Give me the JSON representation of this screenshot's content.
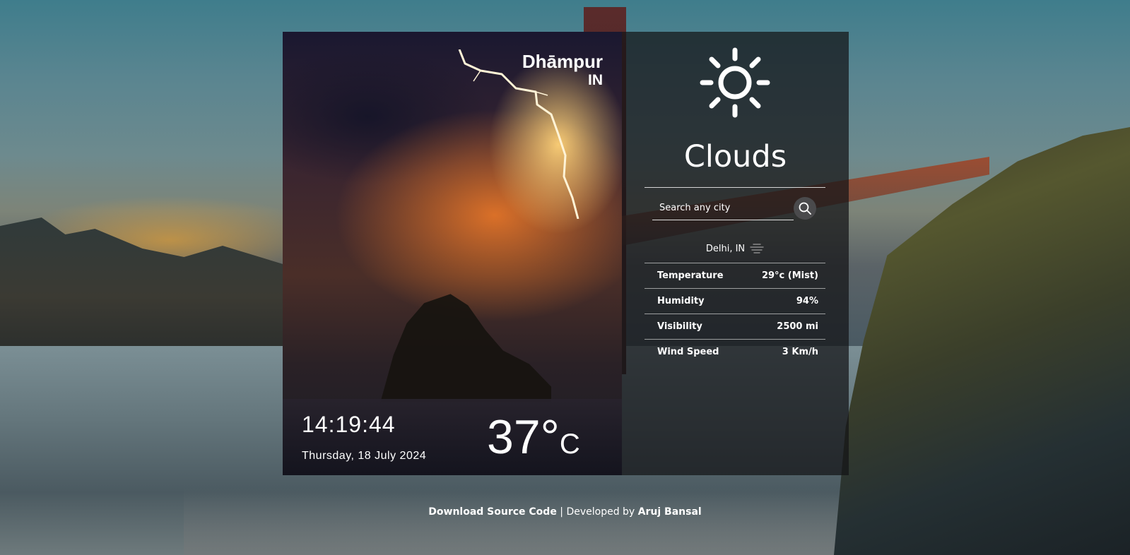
{
  "location": {
    "city": "Dhāmpur",
    "country": "IN"
  },
  "clock": {
    "time": "14:19:44",
    "date": "Thursday, 18 July 2024"
  },
  "current_temp": {
    "value": "37",
    "degree": "°",
    "unit": "C"
  },
  "weather": {
    "icon": "sun-icon",
    "condition": "Clouds"
  },
  "search": {
    "placeholder": "Search any city",
    "button_icon": "search-icon"
  },
  "result": {
    "place": "Delhi, IN",
    "icon": "mist-icon",
    "rows": [
      {
        "label": "Temperature",
        "value": "29°c (Mist)"
      },
      {
        "label": "Humidity",
        "value": "94%"
      },
      {
        "label": "Visibility",
        "value": "2500 mi"
      },
      {
        "label": "Wind Speed",
        "value": "3 Km/h"
      }
    ]
  },
  "footer": {
    "source_link": "Download Source Code",
    "separator": "|",
    "developed_by": "Developed by",
    "developer": "Aruj Bansal"
  },
  "colors": {
    "panel_bg": "#141416",
    "text": "#ffffff",
    "search_button": "#4a4a4c"
  }
}
